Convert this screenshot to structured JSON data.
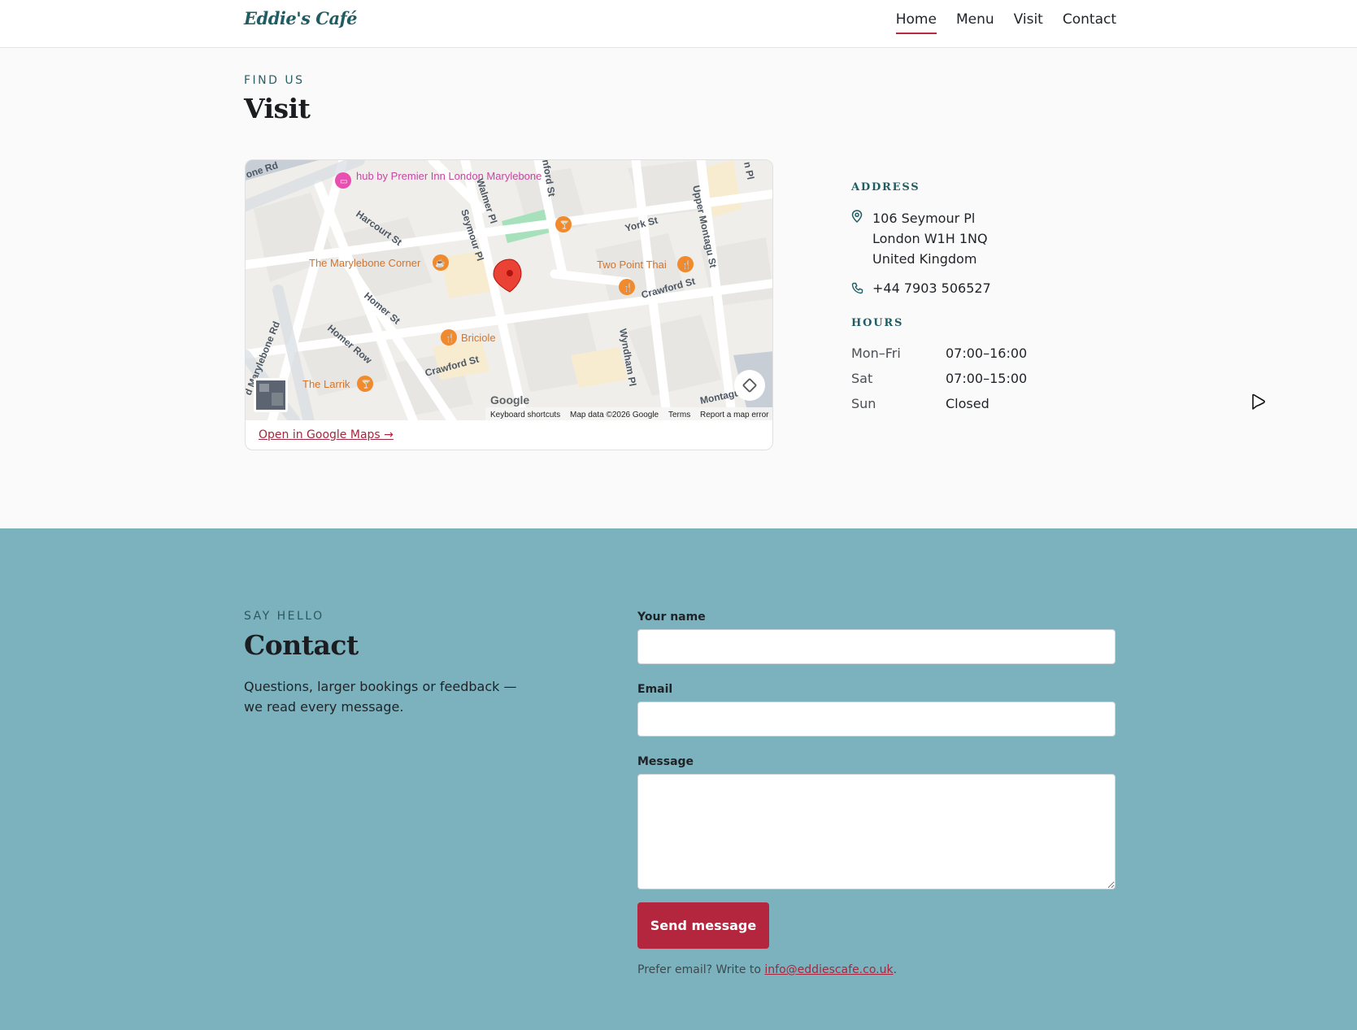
{
  "header": {
    "brand": "Eddie's Café",
    "nav": [
      {
        "label": "Home",
        "active": true
      },
      {
        "label": "Menu",
        "active": false
      },
      {
        "label": "Visit",
        "active": false
      },
      {
        "label": "Contact",
        "active": false
      }
    ]
  },
  "visit": {
    "eyebrow": "FIND US",
    "title": "Visit",
    "map": {
      "street_labels": [
        "one Rd",
        "Harcourt St",
        "Walmer Pl",
        "Seymour Pl",
        "nford St",
        "York St",
        "Upper Montagu St",
        "n Pl",
        "Homer St",
        "Homer Row",
        "Crawford St",
        "Crawford St",
        "Wyndham Pl",
        "d Marylebone Rd",
        "Montagu Pl"
      ],
      "places": [
        "hub by Premier Inn London Marylebone",
        "The Marylebone Corner",
        "Two Point Thai",
        "Briciole",
        "The Larrik"
      ],
      "footer_links": [
        "Keyboard shortcuts",
        "Map data ©2026 Google",
        "Terms",
        "Report a map error"
      ],
      "logo": "Google"
    },
    "map_link": "Open in Google Maps →",
    "address_heading": "ADDRESS",
    "address_lines": [
      "106 Seymour Pl",
      "London W1H 1NQ",
      "United Kingdom"
    ],
    "phone": "+44 7903 506527",
    "hours_heading": "HOURS",
    "hours": [
      {
        "day": "Mon–Fri",
        "time": "07:00–16:00"
      },
      {
        "day": "Sat",
        "time": "07:00–15:00"
      },
      {
        "day": "Sun",
        "time": "Closed"
      }
    ]
  },
  "contact": {
    "eyebrow": "SAY HELLO",
    "title": "Contact",
    "description": "Questions, larger bookings or feedback — we read every message.",
    "fields": {
      "name_label": "Your name",
      "name_value": "",
      "email_label": "Email",
      "email_value": "",
      "message_label": "Message",
      "message_value": ""
    },
    "submit_label": "Send message",
    "note_prefix": "Prefer email? Write to ",
    "email": "info@eddiescafe.co.uk",
    "note_suffix": "."
  },
  "colors": {
    "brand": "#1f5d63",
    "accent": "#b4263d",
    "contact_bg": "#7bb2bd"
  }
}
